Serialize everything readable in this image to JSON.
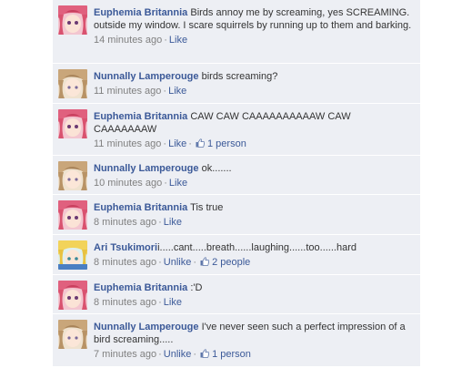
{
  "comments": [
    {
      "author": "Euphemia Britannia",
      "text": "Birds annoy me by screaming, yes SCREAMING. outside my window. I scare squirrels by running up to them and barking.",
      "time": "14 minutes ago",
      "action": "Like",
      "likes": "",
      "avatar": "pink-hair-avatar"
    },
    {
      "author": "Nunnally Lamperouge",
      "text": "birds screaming?",
      "time": "11 minutes ago",
      "action": "Like",
      "likes": "",
      "avatar": "light-brown-hair-avatar"
    },
    {
      "author": "Euphemia Britannia",
      "text": "CAW CAW CAAAAAAAAAAW CAW CAAAAAAAW",
      "time": "11 minutes ago",
      "action": "Like",
      "likes": "1 person",
      "avatar": "pink-hair-avatar"
    },
    {
      "author": "Nunnally Lamperouge",
      "text": "ok.......",
      "time": "10 minutes ago",
      "action": "Like",
      "likes": "",
      "avatar": "light-brown-hair-avatar"
    },
    {
      "author": "Euphemia Britannia",
      "text": "Tis true",
      "time": "8 minutes ago",
      "action": "Like",
      "likes": "",
      "avatar": "pink-hair-avatar"
    },
    {
      "author": "Ari Tsukimori",
      "text": "i.....cant.....breath......laughing......too......hard",
      "time": "8 minutes ago",
      "action": "Unlike",
      "likes": "2 people",
      "avatar": "blonde-hair-avatar"
    },
    {
      "author": "Euphemia Britannia",
      "text": ":'D",
      "time": "8 minutes ago",
      "action": "Like",
      "likes": "",
      "avatar": "pink-hair-avatar"
    },
    {
      "author": "Nunnally Lamperouge",
      "text": "I've never seen such a perfect impression of a bird screaming.....",
      "time": "7 minutes ago",
      "action": "Unlike",
      "likes": "1 person",
      "avatar": "light-brown-hair-avatar"
    }
  ],
  "colors": {
    "background": "#edeff4",
    "link": "#3b5998",
    "meta": "#808080"
  }
}
